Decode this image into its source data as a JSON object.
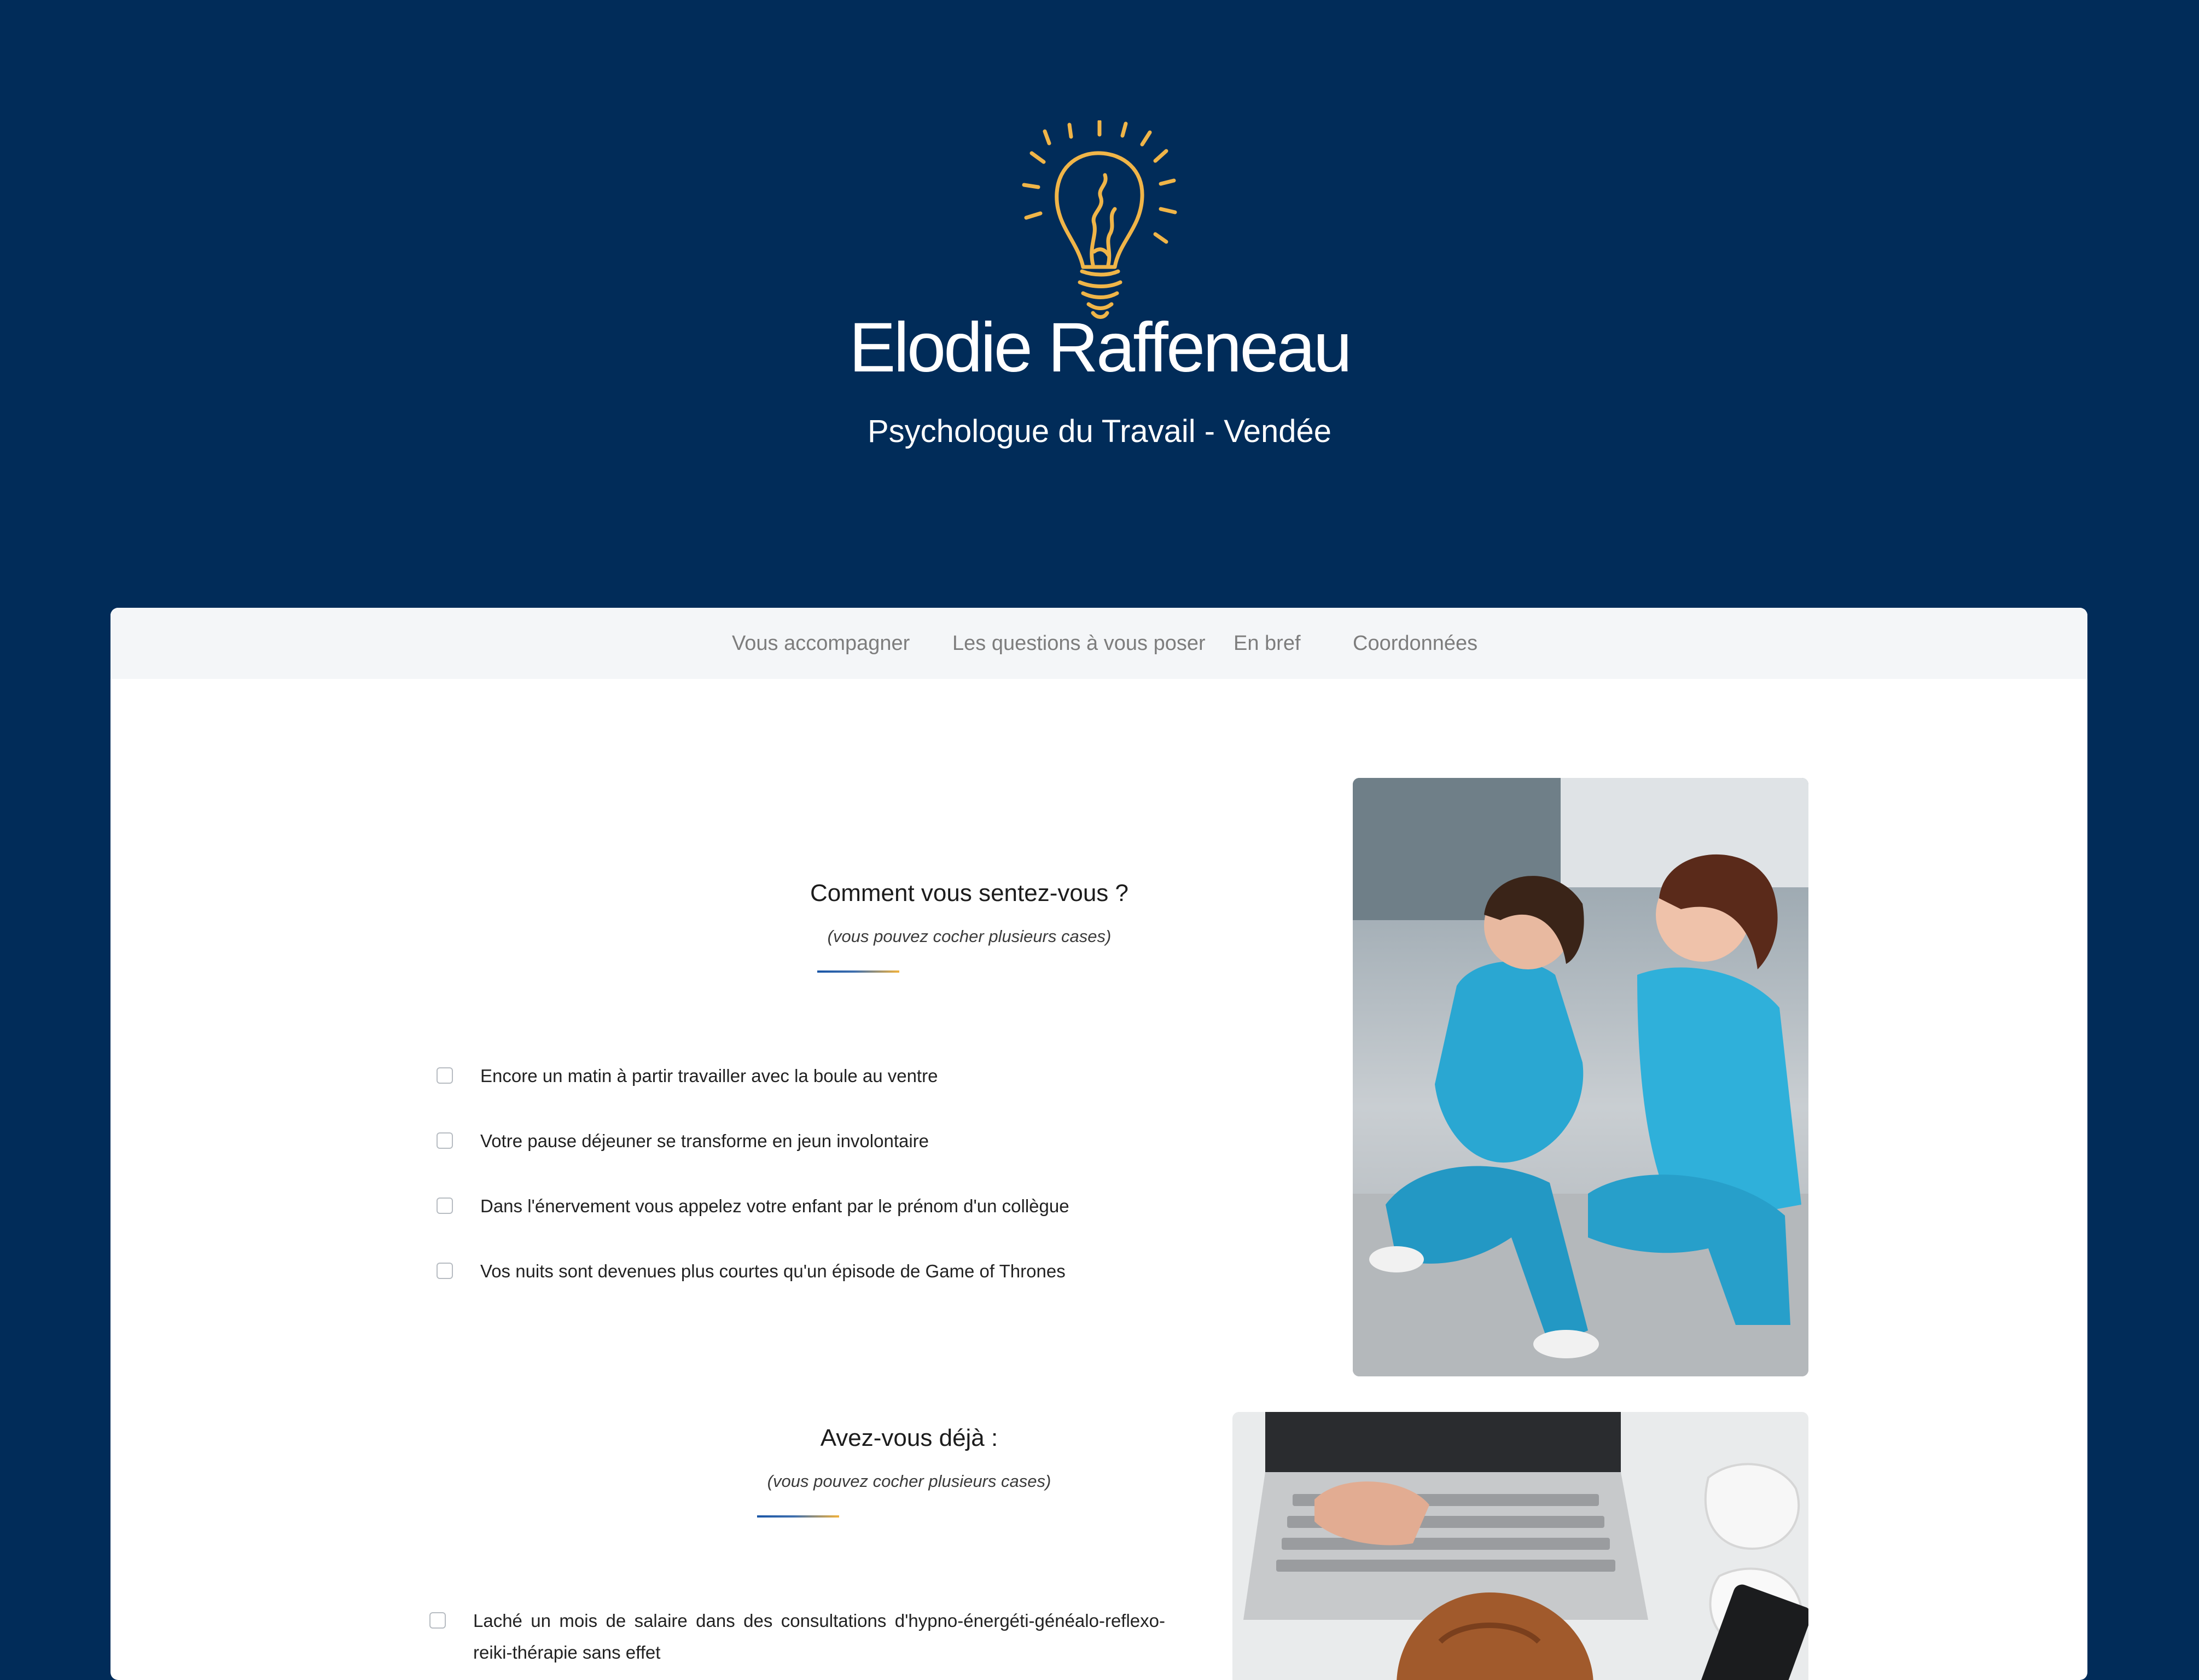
{
  "header": {
    "title": "Elodie Raffeneau",
    "subtitle": "Psychologue du Travail - Vendée",
    "logo_icon": "lightbulb-icon"
  },
  "nav": {
    "items": [
      "Vous accompagner",
      "Les questions à vous poser",
      "En bref",
      "Coordonnées"
    ]
  },
  "section1": {
    "heading": "Comment vous sentez-vous ?",
    "note": "(vous pouvez cocher plusieurs cases)",
    "options": [
      "Encore un matin à partir travailler avec la boule au ventre",
      "Votre pause déjeuner se transforme en jeun involontaire",
      "Dans l'énervement vous appelez votre enfant par le prénom d'un collègue",
      "Vos nuits sont devenues plus courtes qu'un épisode de Game of Thrones"
    ]
  },
  "section2": {
    "heading": "Avez-vous déjà :",
    "note": "(vous pouvez cocher plusieurs cases)",
    "options": [
      "Laché un mois de salaire dans des consultations d'hypno-énergéti-généalo-reflexo-reiki-thérapie sans effet"
    ]
  },
  "colors": {
    "background": "#012c59",
    "accent": "#f2b23b",
    "nav_bg": "#f4f6f8",
    "scrubs": "#2aa7d2"
  }
}
